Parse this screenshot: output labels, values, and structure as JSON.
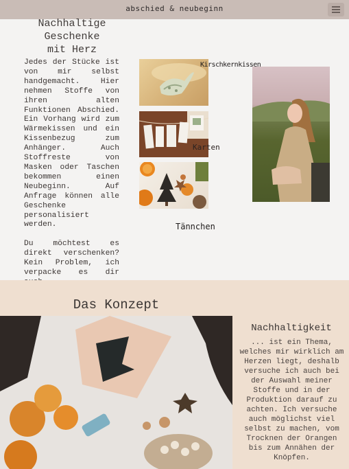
{
  "header": {
    "brand": "Abschied & Neubeginn",
    "menu_icon": "hamburger-icon"
  },
  "intro": {
    "title_lines": [
      "Nachhaltige",
      "Geschenke",
      "mit Herz"
    ],
    "paragraph1": "Jedes der Stücke ist von mir selbst handgemacht. Hier nehmen Stoffe von ihren alten Funktionen Abschied. Ein Vorhang wird zum Wärmekissen und ein Kissenbezug zum Anhänger. Auch Stoffreste von Masken oder Taschen bekommen einen Neubeginn. Auf Anfrage können alle Geschenke personalisiert werden.",
    "paragraph2": "Du möchtest es direkt verschenken? Kein Problem, ich verpacke es dir auch."
  },
  "gallery": {
    "label_kissen": "Kirschkernkissen",
    "label_karten": "Karten",
    "label_tannchen": "Tännchen"
  },
  "concept": {
    "title": "Das Konzept",
    "subtitle": "Nachhaltigkeit",
    "text": "... ist ein Thema, welches mir wirklich am Herzen liegt, deshalb versuche ich auch bei der Auswahl meiner Stoffe und in der Produktion darauf zu achten. Ich versuche auch möglichst viel selbst zu machen, vom Trocknen der Orangen bis zum Annähen der Knöpfen."
  }
}
